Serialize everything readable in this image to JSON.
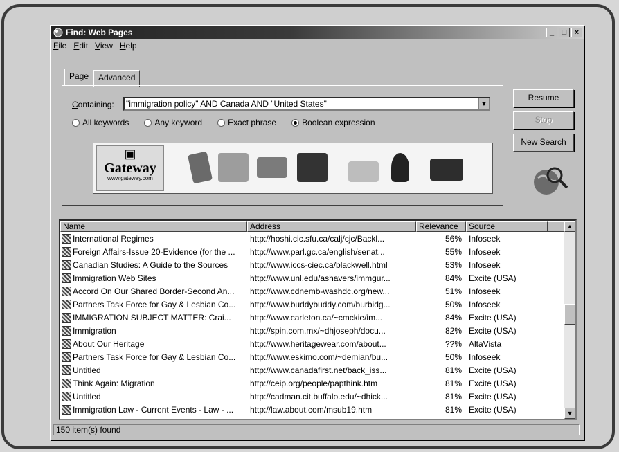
{
  "window": {
    "title": "Find: Web Pages",
    "buttons": [
      "_",
      "□",
      "×"
    ]
  },
  "menu": [
    "File",
    "Edit",
    "View",
    "Help"
  ],
  "tabs": [
    "Page",
    "Advanced"
  ],
  "search": {
    "containing_label": "Containing:",
    "query": "\"immigration policy\" AND Canada AND \"United States\"",
    "options": [
      "All keywords",
      "Any keyword",
      "Exact phrase",
      "Boolean expression"
    ],
    "selected": "Boolean expression"
  },
  "ad": {
    "brand": "Gateway",
    "url": "www.gateway.com"
  },
  "commands": {
    "resume": "Resume",
    "stop": "Stop",
    "new_search": "New Search"
  },
  "results": {
    "columns": [
      "Name",
      "Address",
      "Relevance",
      "Source"
    ],
    "rows": [
      {
        "name": "International Regimes",
        "address": "http://hoshi.cic.sfu.ca/calj/cjc/Backl...",
        "relevance": "56%",
        "source": "Infoseek"
      },
      {
        "name": "Foreign Affairs-Issue 20-Evidence (for the ...",
        "address": "http://www.parl.gc.ca/english/senat...",
        "relevance": "55%",
        "source": "Infoseek"
      },
      {
        "name": "Canadian Studies: A Guide to the Sources",
        "address": "http://www.iccs-ciec.ca/blackwell.html",
        "relevance": "53%",
        "source": "Infoseek"
      },
      {
        "name": "Immigration Web Sites",
        "address": "http://www.unl.edu/ashavers/immgur...",
        "relevance": "84%",
        "source": "Excite (USA)"
      },
      {
        "name": "Accord On Our Shared Border-Second An...",
        "address": "http://www.cdnemb-washdc.org/new...",
        "relevance": "51%",
        "source": "Infoseek"
      },
      {
        "name": "Partners Task Force for Gay & Lesbian Co...",
        "address": "http://www.buddybuddy.com/burbidg...",
        "relevance": "50%",
        "source": "Infoseek"
      },
      {
        "name": "IMMIGRATION SUBJECT MATTER: Crai...",
        "address": "http://www.carleton.ca/~cmckie/im...",
        "relevance": "84%",
        "source": "Excite (USA)"
      },
      {
        "name": "Immigration",
        "address": "http://spin.com.mx/~dhjoseph/docu...",
        "relevance": "82%",
        "source": "Excite (USA)"
      },
      {
        "name": "About Our Heritage",
        "address": "http://www.heritagewear.com/about...",
        "relevance": "??%",
        "source": "AltaVista"
      },
      {
        "name": "Partners Task Force for Gay & Lesbian Co...",
        "address": "http://www.eskimo.com/~demian/bu...",
        "relevance": "50%",
        "source": "Infoseek"
      },
      {
        "name": "Untitled",
        "address": "http://www.canadafirst.net/back_iss...",
        "relevance": "81%",
        "source": "Excite (USA)"
      },
      {
        "name": "Think Again: Migration",
        "address": "http://ceip.org/people/papthink.htm",
        "relevance": "81%",
        "source": "Excite (USA)"
      },
      {
        "name": "Untitled",
        "address": "http://cadman.cit.buffalo.edu/~dhick...",
        "relevance": "81%",
        "source": "Excite (USA)"
      },
      {
        "name": "Immigration Law - Current Events - Law - ...",
        "address": "http://law.about.com/msub19.htm",
        "relevance": "81%",
        "source": "Excite (USA)"
      }
    ]
  },
  "status": "150 item(s) found"
}
